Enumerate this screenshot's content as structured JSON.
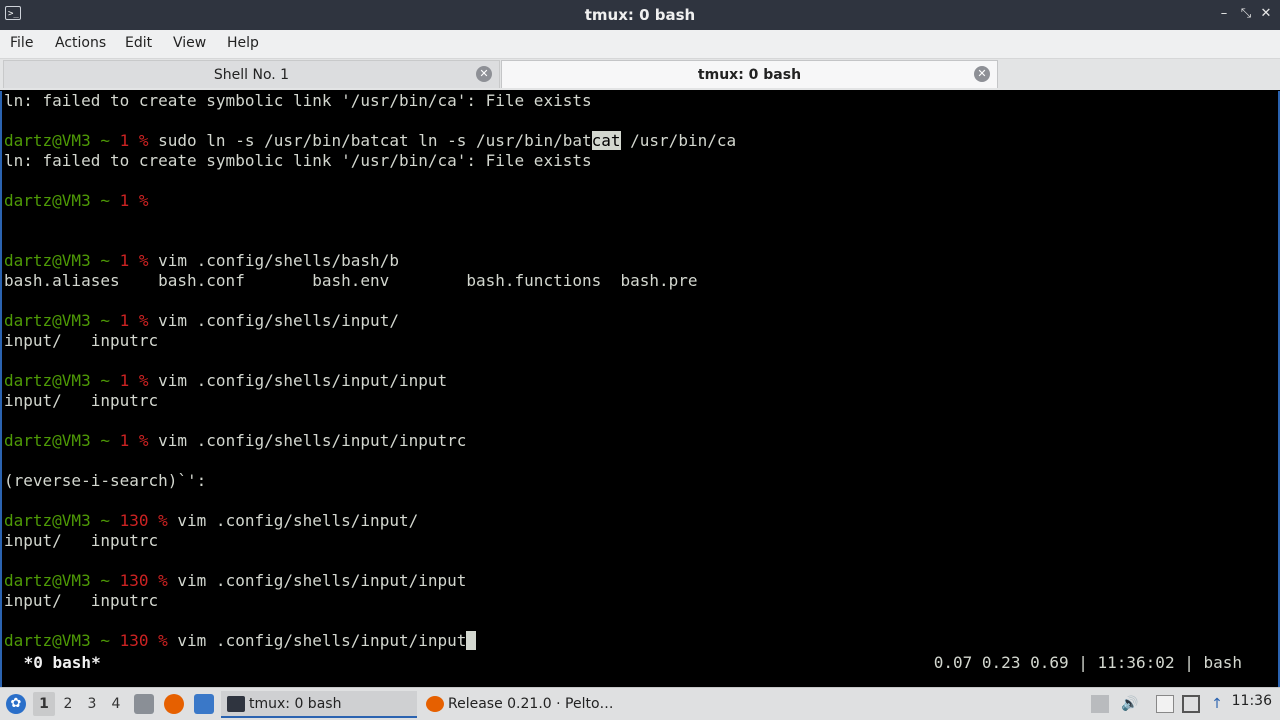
{
  "window": {
    "title": "tmux: 0 bash",
    "app_icon": "terminal-icon",
    "buttons": [
      "minimize-icon",
      "maximize-icon",
      "close-icon"
    ]
  },
  "menu": [
    "File",
    "Actions",
    "Edit",
    "View",
    "Help"
  ],
  "tabs": [
    {
      "label": "Shell No. 1",
      "active": false
    },
    {
      "label": "tmux: 0 bash",
      "active": true
    }
  ],
  "terminal": {
    "lines": [
      {
        "type": "text",
        "text": "ln: failed to create symbolic link '/usr/bin/ca': File exists"
      },
      {
        "type": "blank"
      },
      {
        "type": "prompt",
        "user": "dartz@VM3 ~ ",
        "code": "1 %",
        "cmd_before": " sudo ln -s /usr/bin/batcat ln -s /usr/bin/bat",
        "cmd_highlight": "cat",
        "cmd_after": " /usr/bin/ca"
      },
      {
        "type": "text",
        "text": "ln: failed to create symbolic link '/usr/bin/ca': File exists"
      },
      {
        "type": "blank"
      },
      {
        "type": "prompt",
        "user": "dartz@VM3 ~ ",
        "code": "1 %",
        "cmd_before": "",
        "cmd_highlight": "",
        "cmd_after": ""
      },
      {
        "type": "blank"
      },
      {
        "type": "blank"
      },
      {
        "type": "prompt",
        "user": "dartz@VM3 ~ ",
        "code": "1 %",
        "cmd_before": " vim .config/shells/bash/b",
        "cmd_highlight": "",
        "cmd_after": ""
      },
      {
        "type": "text",
        "text": "bash.aliases    bash.conf       bash.env        bash.functions  bash.pre"
      },
      {
        "type": "blank"
      },
      {
        "type": "prompt",
        "user": "dartz@VM3 ~ ",
        "code": "1 %",
        "cmd_before": " vim .config/shells/input/",
        "cmd_highlight": "",
        "cmd_after": ""
      },
      {
        "type": "text",
        "text": "input/   inputrc"
      },
      {
        "type": "blank"
      },
      {
        "type": "prompt",
        "user": "dartz@VM3 ~ ",
        "code": "1 %",
        "cmd_before": " vim .config/shells/input/input",
        "cmd_highlight": "",
        "cmd_after": ""
      },
      {
        "type": "text",
        "text": "input/   inputrc"
      },
      {
        "type": "blank"
      },
      {
        "type": "prompt",
        "user": "dartz@VM3 ~ ",
        "code": "1 %",
        "cmd_before": " vim .config/shells/input/inputrc",
        "cmd_highlight": "",
        "cmd_after": ""
      },
      {
        "type": "blank"
      },
      {
        "type": "text",
        "text": "(reverse-i-search)`':"
      },
      {
        "type": "blank"
      },
      {
        "type": "prompt",
        "user": "dartz@VM3 ~ ",
        "code": "130 %",
        "cmd_before": " vim .config/shells/input/",
        "cmd_highlight": "",
        "cmd_after": ""
      },
      {
        "type": "text",
        "text": "input/   inputrc"
      },
      {
        "type": "blank"
      },
      {
        "type": "prompt",
        "user": "dartz@VM3 ~ ",
        "code": "130 %",
        "cmd_before": " vim .config/shells/input/input",
        "cmd_highlight": "",
        "cmd_after": ""
      },
      {
        "type": "text",
        "text": "input/   inputrc"
      },
      {
        "type": "blank"
      },
      {
        "type": "prompt",
        "user": "dartz@VM3 ~ ",
        "code": "130 %",
        "cmd_before": " vim .config/shells/input/input",
        "cmd_highlight": "",
        "cmd_after": "",
        "cursor": true
      }
    ],
    "status_left": " *0 bash*",
    "status_right": "0.07 0.23 0.69 | 11:36:02 | bash"
  },
  "taskbar": {
    "start_icon": "start-menu-icon",
    "workspaces": [
      {
        "label": "1",
        "active": true
      },
      {
        "label": "2",
        "active": false
      },
      {
        "label": "3",
        "active": false
      },
      {
        "label": "4",
        "active": false
      }
    ],
    "launchers": [
      "file-manager-icon",
      "firefox-icon",
      "show-desktop-icon"
    ],
    "tasks": [
      {
        "label": "tmux: 0 bash",
        "icon": "terminal-icon",
        "active": true
      },
      {
        "label": "Release 0.21.0 · Pelto…",
        "icon": "firefox-icon",
        "active": false
      }
    ],
    "tray": [
      "eject-icon",
      "volume-icon",
      "clipboard-icon",
      "network-icon",
      "update-icon"
    ],
    "clock": "11:36"
  }
}
